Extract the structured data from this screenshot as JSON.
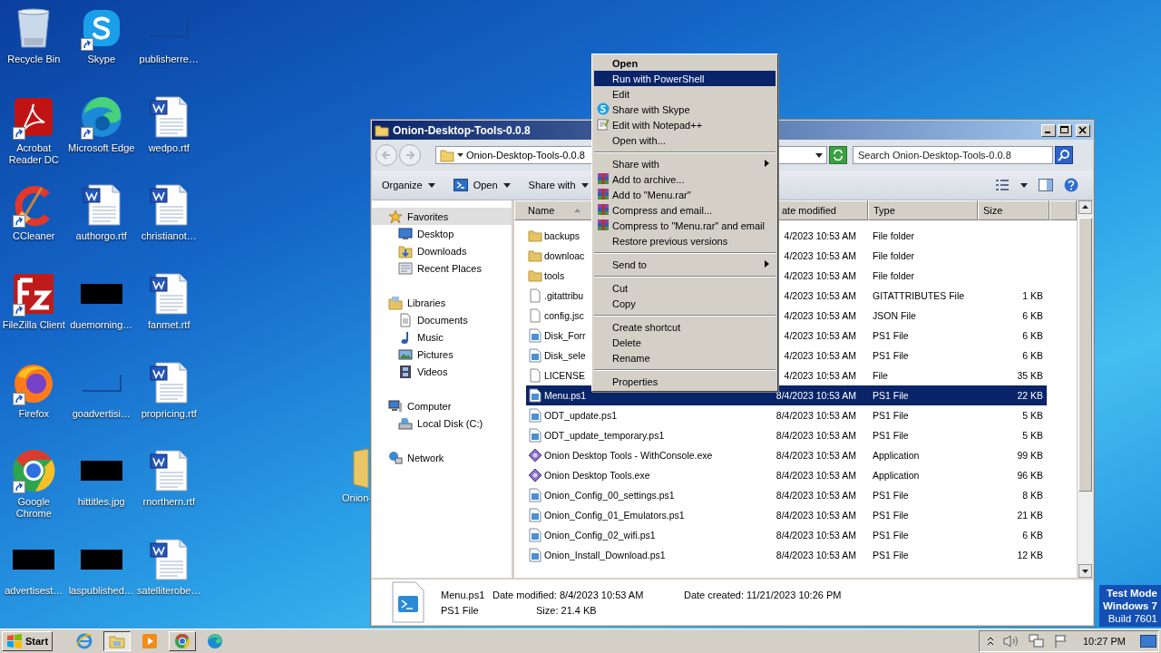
{
  "desktop": {
    "icons": [
      {
        "label": "Recycle Bin",
        "kind": "recycle",
        "shortcut": false
      },
      {
        "label": "Skype",
        "kind": "skype",
        "shortcut": true
      },
      {
        "label": "publisherre…",
        "kind": "blank",
        "shortcut": false
      },
      {
        "label": "Acrobat Reader DC",
        "kind": "acrobat",
        "shortcut": true
      },
      {
        "label": "Microsoft Edge",
        "kind": "edge",
        "shortcut": true
      },
      {
        "label": "wedpo.rtf",
        "kind": "word",
        "shortcut": false
      },
      {
        "label": "CCleaner",
        "kind": "ccleaner",
        "shortcut": true
      },
      {
        "label": "authorgo.rtf",
        "kind": "word",
        "shortcut": false
      },
      {
        "label": "christianot…",
        "kind": "word",
        "shortcut": false
      },
      {
        "label": "FileZilla Client",
        "kind": "filezilla",
        "shortcut": true
      },
      {
        "label": "duemorning…",
        "kind": "thumbnail",
        "shortcut": false
      },
      {
        "label": "fanmet.rtf",
        "kind": "word",
        "shortcut": false
      },
      {
        "label": "Firefox",
        "kind": "firefox",
        "shortcut": true
      },
      {
        "label": "goadvertisi…",
        "kind": "blank",
        "shortcut": false
      },
      {
        "label": "propricing.rtf",
        "kind": "word",
        "shortcut": false
      },
      {
        "label": "Google Chrome",
        "kind": "chrome",
        "shortcut": true
      },
      {
        "label": "hittitles.jpg",
        "kind": "thumbnail",
        "shortcut": false
      },
      {
        "label": "rnorthern.rtf",
        "kind": "word",
        "shortcut": false
      },
      {
        "label": "advertisest…",
        "kind": "thumbnail",
        "shortcut": false
      },
      {
        "label": "laspublished…",
        "kind": "thumbnail",
        "shortcut": false
      },
      {
        "label": "satelliterobe…",
        "kind": "word",
        "shortcut": false
      }
    ],
    "folder_behind_window": {
      "label": "Onion-"
    },
    "test_mode": [
      "Test Mode",
      "Windows 7",
      "Build 7601"
    ]
  },
  "explorer": {
    "title": "Onion-Desktop-Tools-0.0.8",
    "address": "Onion-Desktop-Tools-0.0.8",
    "search": {
      "placeholder": "Search Onion-Desktop-Tools-0.0.8"
    },
    "toolbar": [
      {
        "label": "Organize",
        "kind": "plain"
      },
      {
        "label": "Open",
        "kind": "powershell"
      },
      {
        "label": "Share with",
        "kind": "plain"
      }
    ],
    "navigation": [
      {
        "label": "Favorites",
        "kind": "star",
        "selected": true,
        "children": [
          {
            "label": "Desktop",
            "kind": "desktop",
            "selected": false
          },
          {
            "label": "Downloads",
            "kind": "downloads",
            "selected": false
          },
          {
            "label": "Recent Places",
            "kind": "recent",
            "selected": false
          }
        ]
      },
      {
        "label": "Libraries",
        "kind": "library",
        "selected": false,
        "children": [
          {
            "label": "Documents",
            "kind": "documents",
            "selected": false
          },
          {
            "label": "Music",
            "kind": "music",
            "selected": false
          },
          {
            "label": "Pictures",
            "kind": "pictures",
            "selected": false
          },
          {
            "label": "Videos",
            "kind": "videos",
            "selected": false
          }
        ]
      },
      {
        "label": "Computer",
        "kind": "computer",
        "selected": false,
        "children": [
          {
            "label": "Local Disk (C:)",
            "kind": "disk",
            "selected": false
          }
        ]
      },
      {
        "label": "Network",
        "kind": "network",
        "selected": false
      }
    ],
    "columns": [
      {
        "label": "Name",
        "sorted": true
      },
      {
        "label": "ate modified",
        "sorted": false
      },
      {
        "label": "Type",
        "sorted": false
      },
      {
        "label": "Size",
        "sorted": false
      }
    ],
    "rows": [
      {
        "name": "backups",
        "kind": "folder",
        "date": "4/2023 10:53 AM",
        "type": "File folder",
        "size": "",
        "selected": false
      },
      {
        "name": "downloac",
        "kind": "folder",
        "date": "4/2023 10:53 AM",
        "type": "File folder",
        "size": "",
        "selected": false
      },
      {
        "name": "tools",
        "kind": "folder",
        "date": "4/2023 10:53 AM",
        "type": "File folder",
        "size": "",
        "selected": false
      },
      {
        "name": ".gitattribu",
        "kind": "file",
        "date": "4/2023 10:53 AM",
        "type": "GITATTRIBUTES File",
        "size": "1 KB",
        "selected": false
      },
      {
        "name": "config.jsc",
        "kind": "file",
        "date": "4/2023 10:53 AM",
        "type": "JSON File",
        "size": "6 KB",
        "selected": false
      },
      {
        "name": "Disk_Forr",
        "kind": "ps1",
        "date": "4/2023 10:53 AM",
        "type": "PS1 File",
        "size": "6 KB",
        "selected": false
      },
      {
        "name": "Disk_sele",
        "kind": "ps1",
        "date": "4/2023 10:53 AM",
        "type": "PS1 File",
        "size": "6 KB",
        "selected": false
      },
      {
        "name": "LICENSE",
        "kind": "file",
        "date": "4/2023 10:53 AM",
        "type": "File",
        "size": "35 KB",
        "selected": false
      },
      {
        "name": "Menu.ps1",
        "kind": "ps1",
        "date": "8/4/2023 10:53 AM",
        "type": "PS1 File",
        "size": "22 KB",
        "selected": true
      },
      {
        "name": "ODT_update.ps1",
        "kind": "ps1",
        "date": "8/4/2023 10:53 AM",
        "type": "PS1 File",
        "size": "5 KB",
        "selected": false
      },
      {
        "name": "ODT_update_temporary.ps1",
        "kind": "ps1",
        "date": "8/4/2023 10:53 AM",
        "type": "PS1 File",
        "size": "5 KB",
        "selected": false
      },
      {
        "name": "Onion Desktop Tools - WithConsole.exe",
        "kind": "exe",
        "date": "8/4/2023 10:53 AM",
        "type": "Application",
        "size": "99 KB",
        "selected": false
      },
      {
        "name": "Onion Desktop Tools.exe",
        "kind": "exe",
        "date": "8/4/2023 10:53 AM",
        "type": "Application",
        "size": "96 KB",
        "selected": false
      },
      {
        "name": "Onion_Config_00_settings.ps1",
        "kind": "ps1",
        "date": "8/4/2023 10:53 AM",
        "type": "PS1 File",
        "size": "8 KB",
        "selected": false
      },
      {
        "name": "Onion_Config_01_Emulators.ps1",
        "kind": "ps1",
        "date": "8/4/2023 10:53 AM",
        "type": "PS1 File",
        "size": "21 KB",
        "selected": false
      },
      {
        "name": "Onion_Config_02_wifi.ps1",
        "kind": "ps1",
        "date": "8/4/2023 10:53 AM",
        "type": "PS1 File",
        "size": "6 KB",
        "selected": false
      },
      {
        "name": "Onion_Install_Download.ps1",
        "kind": "ps1",
        "date": "8/4/2023 10:53 AM",
        "type": "PS1 File",
        "size": "12 KB",
        "selected": false
      }
    ],
    "details": {
      "name": "Menu.ps1",
      "modified": "Date modified: 8/4/2023 10:53 AM",
      "created": "Date created: 11/21/2023 10:26 PM",
      "type": "PS1 File",
      "size": "Size: 21.4 KB"
    }
  },
  "context_menu": {
    "items": [
      {
        "label": "Open",
        "kind": "plain",
        "default": true,
        "selected": false,
        "submenu": false
      },
      {
        "label": "Run with PowerShell",
        "kind": "plain",
        "default": false,
        "selected": true,
        "submenu": false
      },
      {
        "label": "Edit",
        "kind": "plain",
        "default": false,
        "selected": false,
        "submenu": false
      },
      {
        "label": "Share with Skype",
        "kind": "skype",
        "default": false,
        "selected": false,
        "submenu": false
      },
      {
        "label": "Edit with Notepad++",
        "kind": "notepad",
        "default": false,
        "selected": false,
        "submenu": false
      },
      {
        "label": "Open with...",
        "kind": "plain",
        "default": false,
        "selected": false,
        "submenu": false
      },
      {
        "kind": "separator"
      },
      {
        "label": "Share with",
        "kind": "plain",
        "default": false,
        "selected": false,
        "submenu": true
      },
      {
        "label": "Add to archive...",
        "kind": "archive",
        "default": false,
        "selected": false,
        "submenu": false
      },
      {
        "label": "Add to \"Menu.rar\"",
        "kind": "archive",
        "default": false,
        "selected": false,
        "submenu": false
      },
      {
        "label": "Compress and email...",
        "kind": "archive",
        "default": false,
        "selected": false,
        "submenu": false
      },
      {
        "label": "Compress to \"Menu.rar\" and email",
        "kind": "archive",
        "default": false,
        "selected": false,
        "submenu": false
      },
      {
        "label": "Restore previous versions",
        "kind": "plain",
        "default": false,
        "selected": false,
        "submenu": false
      },
      {
        "kind": "separator"
      },
      {
        "label": "Send to",
        "kind": "plain",
        "default": false,
        "selected": false,
        "submenu": true
      },
      {
        "kind": "separator"
      },
      {
        "label": "Cut",
        "kind": "plain",
        "default": false,
        "selected": false,
        "submenu": false
      },
      {
        "label": "Copy",
        "kind": "plain",
        "default": false,
        "selected": false,
        "submenu": false
      },
      {
        "kind": "separator"
      },
      {
        "label": "Create shortcut",
        "kind": "plain",
        "default": false,
        "selected": false,
        "submenu": false
      },
      {
        "label": "Delete",
        "kind": "plain",
        "default": false,
        "selected": false,
        "submenu": false
      },
      {
        "label": "Rename",
        "kind": "plain",
        "default": false,
        "selected": false,
        "submenu": false
      },
      {
        "kind": "separator"
      },
      {
        "label": "Properties",
        "kind": "plain",
        "default": false,
        "selected": false,
        "submenu": false
      }
    ]
  },
  "taskbar": {
    "start": "Start",
    "apps": [
      {
        "kind": "ie",
        "running": false,
        "active": false
      },
      {
        "kind": "folder",
        "running": true,
        "active": true
      },
      {
        "kind": "media",
        "running": false,
        "active": false
      },
      {
        "kind": "chrome",
        "running": true,
        "active": false
      },
      {
        "kind": "edge",
        "running": false,
        "active": false
      }
    ],
    "clock": "10:27 PM"
  }
}
